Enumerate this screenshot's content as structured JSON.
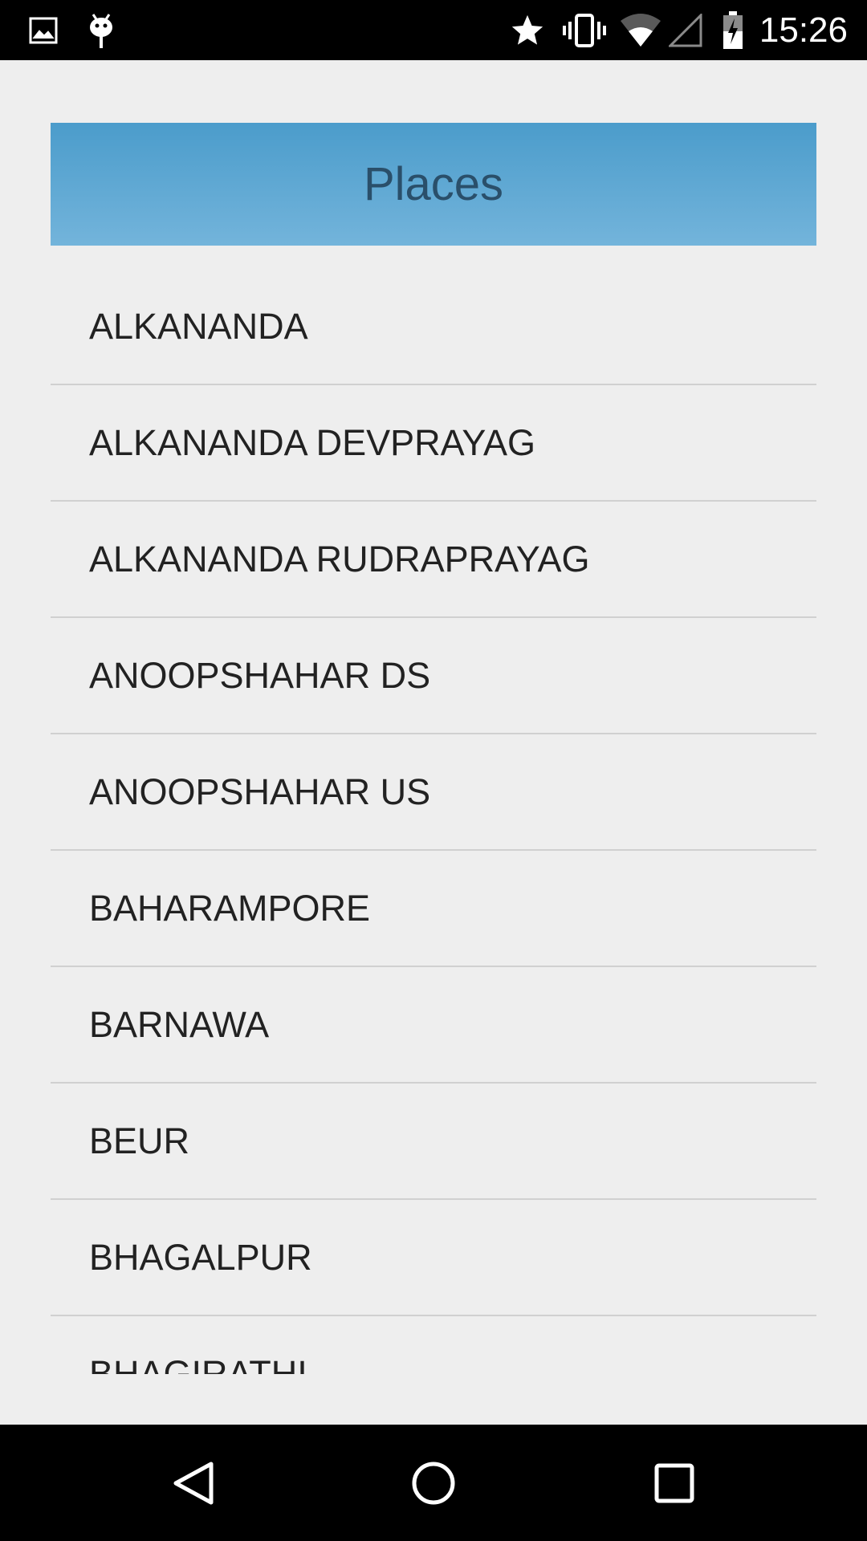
{
  "status_bar": {
    "time": "15:26",
    "icons": [
      "image-notification-icon",
      "android-debug-icon",
      "star-icon",
      "vibrate-icon",
      "wifi-icon",
      "signal-icon",
      "battery-charging-icon"
    ]
  },
  "header": {
    "title": "Places",
    "gradient_top": "#4b9ccb",
    "gradient_bottom": "#73b4db"
  },
  "places": [
    {
      "label": "ALKANANDA"
    },
    {
      "label": "ALKANANDA DEVPRAYAG"
    },
    {
      "label": "ALKANANDA RUDRAPRAYAG"
    },
    {
      "label": "ANOOPSHAHAR DS"
    },
    {
      "label": "ANOOPSHAHAR US"
    },
    {
      "label": "BAHARAMPORE"
    },
    {
      "label": "BARNAWA"
    },
    {
      "label": "BEUR"
    },
    {
      "label": "BHAGALPUR"
    },
    {
      "label": "BHAGIRATHI"
    }
  ],
  "nav_bar": {
    "buttons": [
      "back-icon",
      "home-icon",
      "recents-icon"
    ]
  }
}
